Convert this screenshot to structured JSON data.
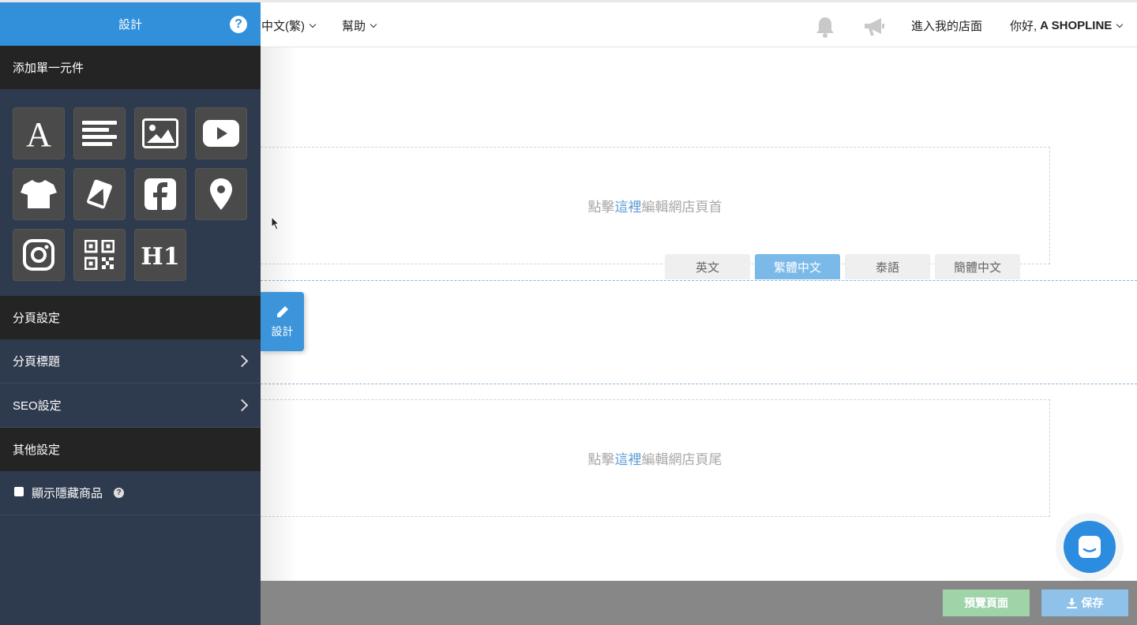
{
  "topbar": {
    "language": "中文(繁)",
    "help": "幫助",
    "enter_store": "進入我的店面",
    "greeting": "你好,",
    "user": "A SHOPLINE"
  },
  "sidebar": {
    "title": "設計",
    "help_icon": "?",
    "section_add": "添加單一元件",
    "widgets": [
      "text-icon",
      "paragraph-icon",
      "image-icon",
      "youtube-icon",
      "product-icon",
      "tags-icon",
      "facebook-icon",
      "map-pin-icon",
      "instagram-icon",
      "qrcode-icon",
      "heading-icon"
    ],
    "widget_heading_label": "H1",
    "section_page": "分頁設定",
    "page_title_item": "分頁標題",
    "seo_item": "SEO設定",
    "section_other": "其他設定",
    "show_hidden_label": "顯示隱藏商品"
  },
  "canvas": {
    "header_prefix": "點擊",
    "header_link": "這裡",
    "header_suffix": "編輯網店頁首",
    "footer_prefix": "點擊",
    "footer_link": "這裡",
    "footer_suffix": "編輯網店頁尾",
    "lang_tabs": [
      "英文",
      "繁體中文",
      "泰語",
      "簡體中文"
    ],
    "active_lang": "繁體中文",
    "design_tab": "設計"
  },
  "bottombar": {
    "preview": "預覽頁面",
    "save": "保存"
  },
  "colors": {
    "primary": "#3290db",
    "sidebar_bg": "#2e3a4e",
    "section_bg": "#242424",
    "preview_btn": "#9fd3a8",
    "save_btn": "#8ec2ea"
  }
}
